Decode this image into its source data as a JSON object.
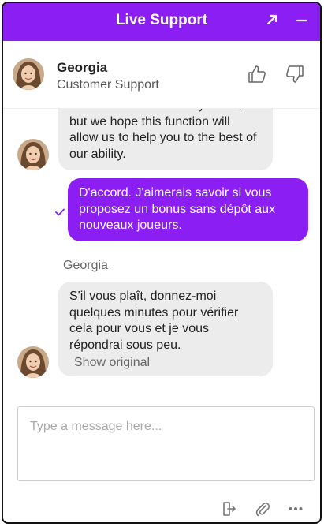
{
  "window": {
    "title": "Live Support",
    "accent": "#8a1ef3",
    "expand_icon": "expand-arrow-icon",
    "minimize_icon": "minimize-icon"
  },
  "agent": {
    "name": "Georgia",
    "role": "Customer Support"
  },
  "messages": [
    {
      "from": "agent",
      "text": "errors in translation may occur, but we hope this function will allow us to help you to the best of our ability."
    },
    {
      "from": "user",
      "text": "D'accord. J'aimerais savoir si vous proposez un bonus sans dépôt aux nouveaux joueurs.",
      "status_icon": "check-icon"
    },
    {
      "from": "agent",
      "sender_label": "Georgia",
      "text": "S'il vous plaît, donnez-moi quelques minutes pour vérifier cela pour vous et je vous répondrai sous peu.",
      "show_original": "Show original"
    }
  ],
  "composer": {
    "placeholder": "Type a message here..."
  },
  "toolbar": {
    "icons": [
      "exit-icon",
      "paperclip-icon",
      "more-icon"
    ]
  }
}
